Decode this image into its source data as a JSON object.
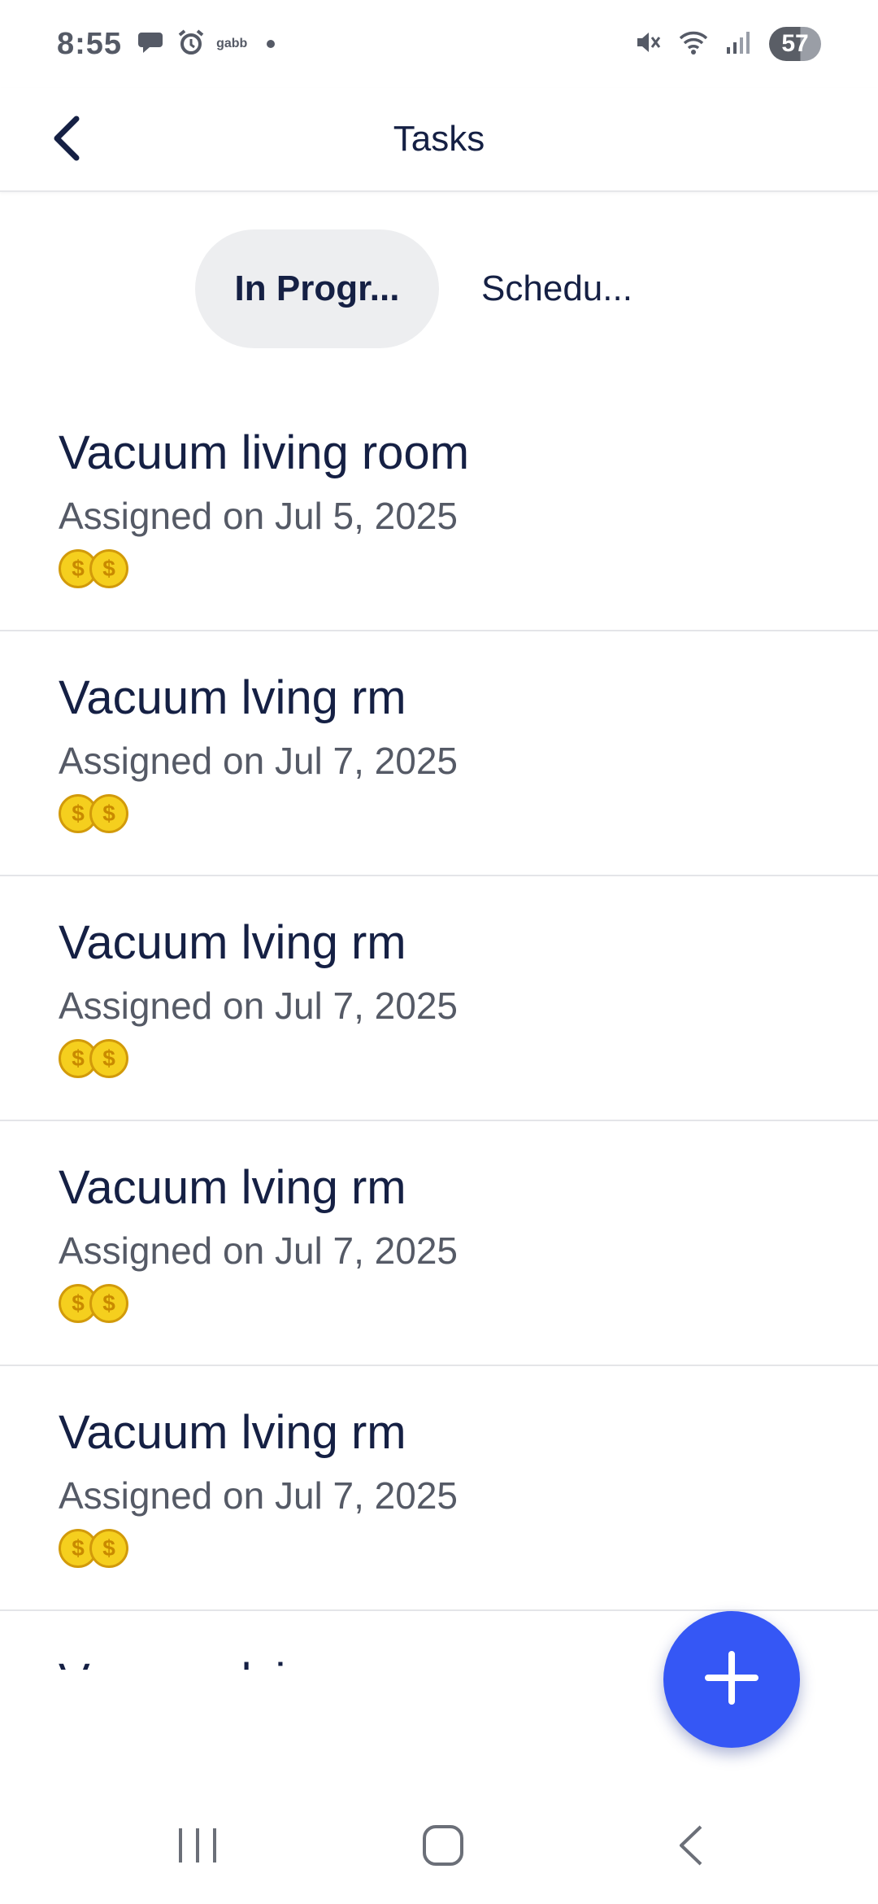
{
  "status_bar": {
    "time": "8:55",
    "carrier": "gabb",
    "battery": "57",
    "icons": [
      "chat-icon",
      "alarm-icon",
      "mute-icon",
      "wifi-icon",
      "signal-icon"
    ]
  },
  "header": {
    "title": "Tasks",
    "back_icon": "chevron-left-icon"
  },
  "tabs": [
    {
      "label": "In Progr...",
      "selected": true
    },
    {
      "label": "Schedu...",
      "selected": false
    }
  ],
  "tasks": [
    {
      "title": "Vacuum living room",
      "date": "Assigned on Jul 5, 2025",
      "coins": [
        "$",
        "$"
      ]
    },
    {
      "title": "Vacuum lving rm",
      "date": "Assigned on Jul 7, 2025",
      "coins": [
        "$",
        "$"
      ]
    },
    {
      "title": "Vacuum lving rm",
      "date": "Assigned on Jul 7, 2025",
      "coins": [
        "$",
        "$"
      ]
    },
    {
      "title": "Vacuum lving rm",
      "date": "Assigned on Jul 7, 2025",
      "coins": [
        "$",
        "$"
      ]
    },
    {
      "title": "Vacuum lving rm",
      "date": "Assigned on Jul 7, 2025",
      "coins": [
        "$",
        "$"
      ]
    }
  ],
  "partial_task": {
    "title": "Vacuum lving rm"
  },
  "fab": {
    "icon": "plus-icon"
  },
  "colors": {
    "primary": "#3557f5",
    "text_dark": "#152044",
    "text_muted": "#555a66",
    "coin": "#f5cf1e",
    "tab_selected_bg": "#edeef0"
  },
  "nav": {
    "icons": [
      "recent-apps-icon",
      "home-icon",
      "back-icon"
    ]
  }
}
